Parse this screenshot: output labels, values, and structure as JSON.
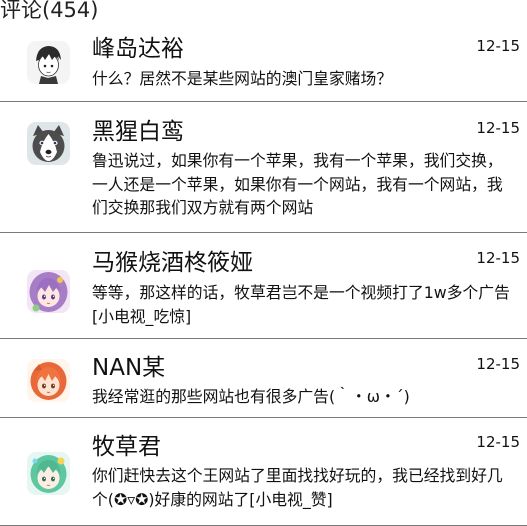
{
  "header": {
    "title": "评论(454)"
  },
  "comments": [
    {
      "user": "峰岛达裕",
      "date": "12-15",
      "text": "什么？居然不是某些网站的澳门皇家赌场？",
      "avatar": "manga-boy-avatar"
    },
    {
      "user": "黑猩白鸾",
      "date": "12-15",
      "text": "鲁迅说过，如果你有一个苹果，我有一个苹果，我们交换，一人还是一个苹果，如果你有一个网站，我有一个网站，我们交换那我们双方就有两个网站",
      "avatar": "husky-avatar"
    },
    {
      "user": "马猴烧酒柊筱娅",
      "date": "12-15",
      "text": "等等，那这样的话，牧草君岂不是一个视频打了1w多个广告[小电视_吃惊]",
      "avatar": "purple-hair-girl-avatar"
    },
    {
      "user": "NAN某",
      "date": "12-15",
      "text": "我经常逛的那些网站也有很多广告(｀・ω・´)",
      "avatar": "orange-hair-girl-avatar"
    },
    {
      "user": "牧草君",
      "date": "12-15",
      "text": "你们赶快去这个王网站了里面找找好玩的，我已经找到好几个(✪▿✪)好康的网站了[小电视_赞]",
      "avatar": "green-hair-girl-avatar"
    }
  ]
}
